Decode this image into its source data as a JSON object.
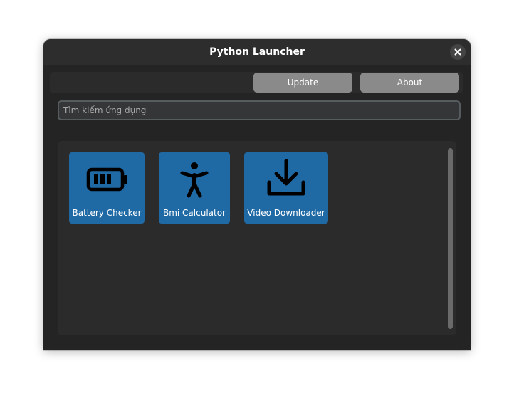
{
  "window": {
    "title": "Python Launcher",
    "close_icon": "close-icon"
  },
  "toolbar": {
    "update_label": "Update",
    "about_label": "About"
  },
  "search": {
    "placeholder": "Tìm kiếm ứng dụng"
  },
  "apps": [
    {
      "label": "Battery Checker",
      "icon": "battery-icon"
    },
    {
      "label": "Bmi Calculator",
      "icon": "person-icon"
    },
    {
      "label": "Video Downloader",
      "icon": "download-icon"
    }
  ],
  "colors": {
    "window_bg": "#242424",
    "titlebar_bg": "#2d2d2d",
    "tile_bg": "#1f6aa5",
    "button_bg": "#8a8a8a",
    "panel_bg": "#2b2b2b"
  }
}
